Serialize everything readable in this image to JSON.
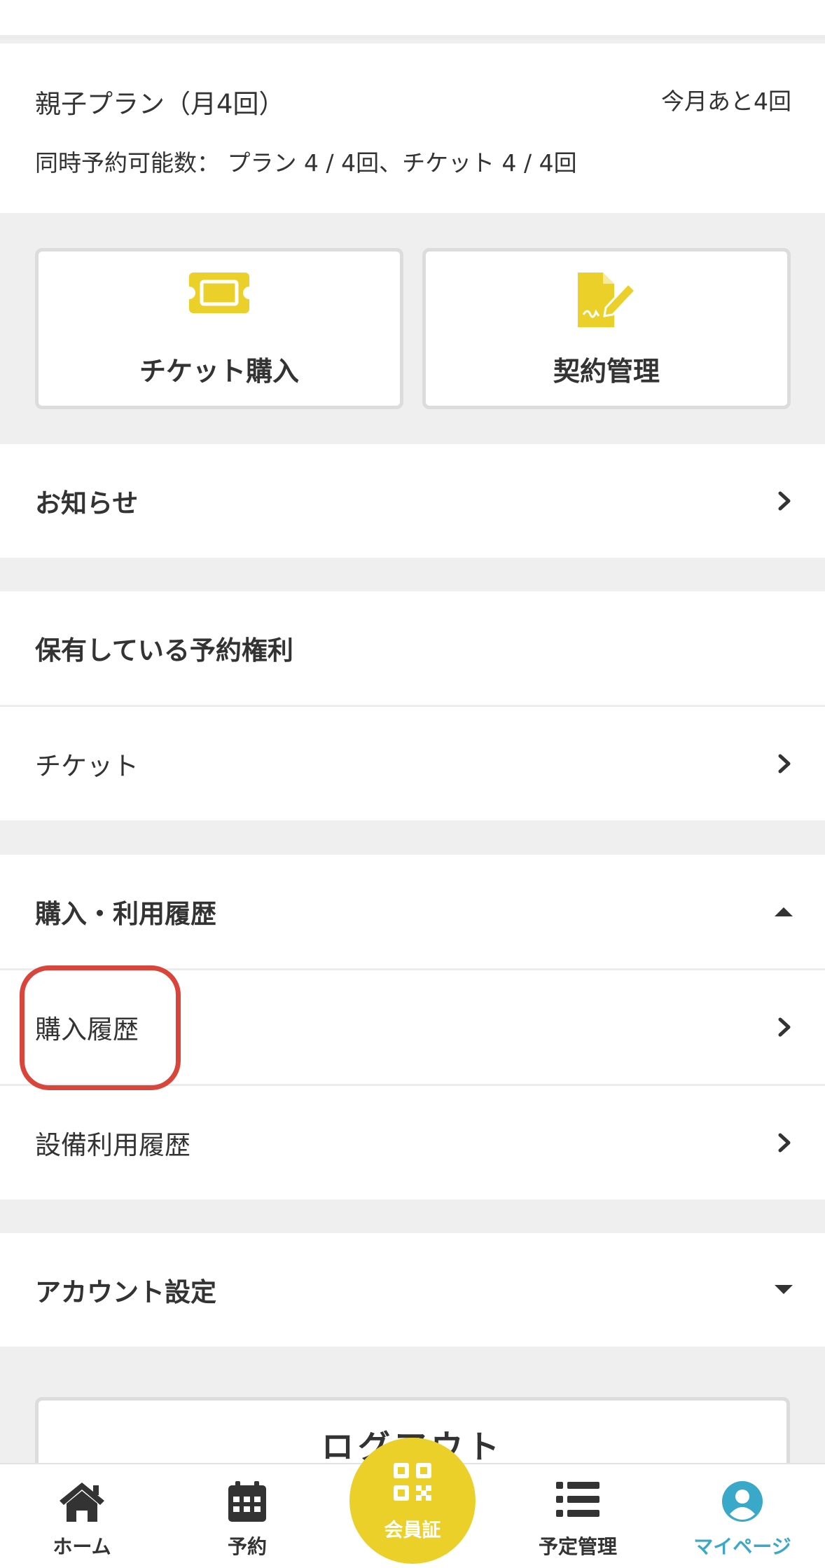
{
  "plan": {
    "name": "親子プラン（月4回）",
    "remaining": "今月あと4回",
    "concurrent": "同時予約可能数： プラン 4 / 4回、チケット 4 / 4回"
  },
  "actions": {
    "ticket_purchase": "チケット購入",
    "contract_management": "契約管理"
  },
  "sections": {
    "notices": "お知らせ",
    "reservation_rights": {
      "title": "保有している予約権利",
      "items": [
        "チケット"
      ]
    },
    "history": {
      "title": "購入・利用履歴",
      "items": [
        "購入履歴",
        "設備利用履歴"
      ]
    },
    "account": "アカウント設定"
  },
  "logout": "ログアウト",
  "tabs": [
    {
      "label": "ホーム",
      "icon": "home-icon"
    },
    {
      "label": "予約",
      "icon": "calendar-icon"
    },
    {
      "label": "会員証",
      "icon": "qr-code-icon"
    },
    {
      "label": "予定管理",
      "icon": "list-icon"
    },
    {
      "label": "マイページ",
      "icon": "user-icon"
    }
  ],
  "colors": {
    "accent_yellow": "#ecd02a",
    "active_tab": "#3aa8c8",
    "highlight_red": "#d9453a"
  }
}
